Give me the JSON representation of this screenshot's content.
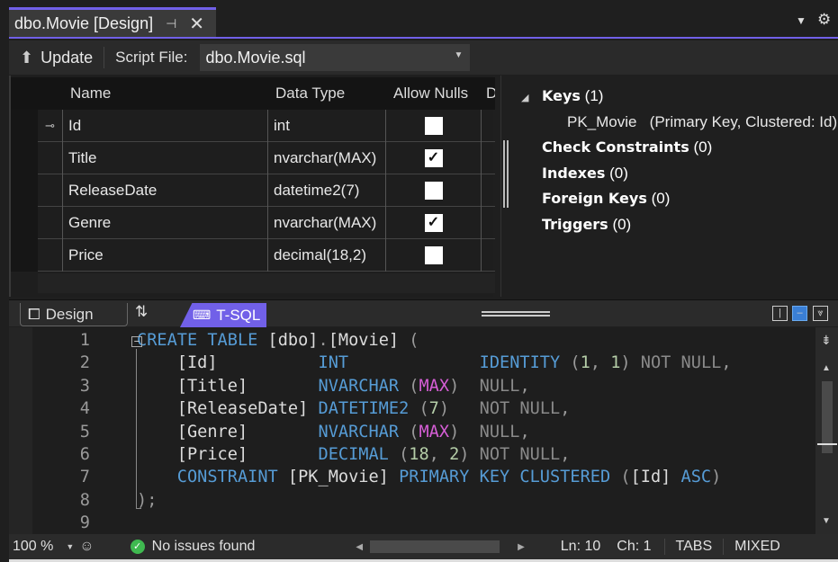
{
  "tab": {
    "title": "dbo.Movie [Design]",
    "pin_icon": "pin-icon",
    "close_icon": "close-icon"
  },
  "colors": {
    "accent": "#7160e8",
    "keyword": "#569cd6",
    "number": "#b5cea8",
    "function": "#d65ed6",
    "gray": "#8a8a8a"
  },
  "toolbar": {
    "update_label": "Update",
    "script_file_label": "Script File:",
    "script_file_value": "dbo.Movie.sql"
  },
  "grid": {
    "headers": [
      "Name",
      "Data Type",
      "Allow Nulls",
      "D"
    ],
    "rows": [
      {
        "name": "Id",
        "type": "int",
        "allow_nulls": false,
        "primary_key": true
      },
      {
        "name": "Title",
        "type": "nvarchar(MAX)",
        "allow_nulls": true
      },
      {
        "name": "ReleaseDate",
        "type": "datetime2(7)",
        "allow_nulls": false
      },
      {
        "name": "Genre",
        "type": "nvarchar(MAX)",
        "allow_nulls": true
      },
      {
        "name": "Price",
        "type": "decimal(18,2)",
        "allow_nulls": false
      }
    ]
  },
  "properties": {
    "keys": {
      "label": "Keys",
      "count": "(1)"
    },
    "pk": {
      "name": "PK_Movie",
      "desc": "(Primary Key, Clustered: Id)"
    },
    "check": {
      "label": "Check Constraints",
      "count": "(0)"
    },
    "indexes": {
      "label": "Indexes",
      "count": "(0)"
    },
    "foreign": {
      "label": "Foreign Keys",
      "count": "(0)"
    },
    "triggers": {
      "label": "Triggers",
      "count": "(0)"
    }
  },
  "pane_tabs": {
    "design": "Design",
    "tsql": "T-SQL"
  },
  "code": [
    [
      [
        "CREATE TABLE ",
        "kw"
      ],
      [
        "[dbo]",
        "id"
      ],
      [
        ".",
        "pn"
      ],
      [
        "[Movie]",
        "id"
      ],
      [
        " (",
        "pn"
      ]
    ],
    [
      [
        "    [Id]",
        "id"
      ],
      [
        "          ",
        ""
      ],
      [
        "INT",
        "kw"
      ],
      [
        "             ",
        ""
      ],
      [
        "IDENTITY",
        "kw"
      ],
      [
        " (",
        "pn"
      ],
      [
        "1",
        "num"
      ],
      [
        ", ",
        "pn"
      ],
      [
        "1",
        "num"
      ],
      [
        ") ",
        "pn"
      ],
      [
        "NOT NULL",
        "gr"
      ],
      [
        ",",
        "pn"
      ]
    ],
    [
      [
        "    [Title]",
        "id"
      ],
      [
        "       ",
        ""
      ],
      [
        "NVARCHAR",
        "kw"
      ],
      [
        " (",
        "pn"
      ],
      [
        "MAX",
        "fn"
      ],
      [
        ")",
        "pn"
      ],
      [
        "  ",
        ""
      ],
      [
        "NULL",
        "gr"
      ],
      [
        ",",
        "pn"
      ]
    ],
    [
      [
        "    [ReleaseDate]",
        "id"
      ],
      [
        " ",
        ""
      ],
      [
        "DATETIME2",
        "kw"
      ],
      [
        " (",
        "pn"
      ],
      [
        "7",
        "num"
      ],
      [
        ")",
        "pn"
      ],
      [
        "   ",
        ""
      ],
      [
        "NOT NULL",
        "gr"
      ],
      [
        ",",
        "pn"
      ]
    ],
    [
      [
        "    [Genre]",
        "id"
      ],
      [
        "       ",
        ""
      ],
      [
        "NVARCHAR",
        "kw"
      ],
      [
        " (",
        "pn"
      ],
      [
        "MAX",
        "fn"
      ],
      [
        ")",
        "pn"
      ],
      [
        "  ",
        ""
      ],
      [
        "NULL",
        "gr"
      ],
      [
        ",",
        "pn"
      ]
    ],
    [
      [
        "    [Price]",
        "id"
      ],
      [
        "       ",
        ""
      ],
      [
        "DECIMAL",
        "kw"
      ],
      [
        " (",
        "pn"
      ],
      [
        "18",
        "num"
      ],
      [
        ", ",
        "pn"
      ],
      [
        "2",
        "num"
      ],
      [
        ") ",
        "pn"
      ],
      [
        "NOT NULL",
        "gr"
      ],
      [
        ",",
        "pn"
      ]
    ],
    [
      [
        "    CONSTRAINT ",
        "kw"
      ],
      [
        "[PK_Movie]",
        "id"
      ],
      [
        " PRIMARY KEY CLUSTERED ",
        "kw"
      ],
      [
        "(",
        "pn"
      ],
      [
        "[Id]",
        "id"
      ],
      [
        " ASC",
        "kw"
      ],
      [
        ")",
        "pn"
      ]
    ],
    [
      [
        ");",
        "pn"
      ]
    ],
    [
      [
        "",
        ""
      ]
    ]
  ],
  "status": {
    "zoom": "100 %",
    "issues": "No issues found",
    "line": "Ln: 10",
    "char": "Ch: 1",
    "tabs": "TABS",
    "eol": "MIXED"
  }
}
